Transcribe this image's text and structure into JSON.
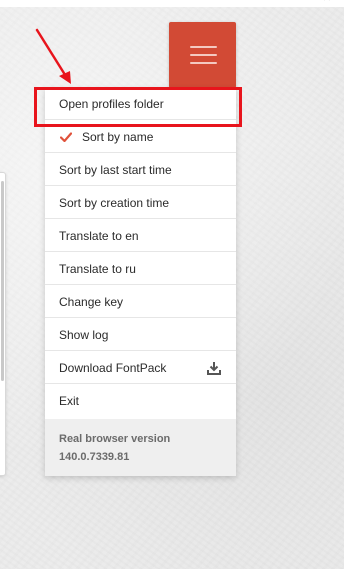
{
  "window": {
    "minimize_glyph": "—",
    "close_glyph": "✕"
  },
  "menu_button": {
    "icon": "hamburger-menu-icon",
    "color": "#d24a35"
  },
  "menu": {
    "items": [
      {
        "label": "Open profiles folder"
      },
      {
        "label": "Sort by name",
        "checked": true,
        "icon": "checkmark-icon",
        "icon_color": "#e0523b"
      },
      {
        "label": "Sort by last start time"
      },
      {
        "label": "Sort by creation time"
      },
      {
        "label": "Translate to en"
      },
      {
        "label": "Translate to ru"
      },
      {
        "label": "Change key"
      },
      {
        "label": "Show log"
      },
      {
        "label": "Download FontPack",
        "icon": "download-icon"
      },
      {
        "label": "Exit"
      }
    ],
    "footer": {
      "title": "Real browser version",
      "version": "140.0.7339.81"
    }
  },
  "annotation": {
    "color": "#e8141c",
    "highlight_target": "Open profiles folder"
  }
}
